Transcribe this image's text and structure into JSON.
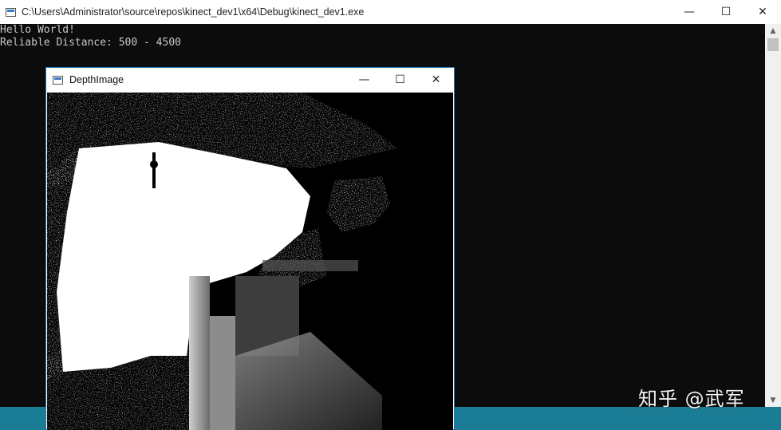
{
  "console": {
    "title": "C:\\Users\\Administrator\\source\\repos\\kinect_dev1\\x64\\Debug\\kinect_dev1.exe",
    "lines": [
      "Hello World!",
      "Reliable Distance: 500 - 4500"
    ],
    "minimize_glyph": "—",
    "maximize_glyph": "☐",
    "close_glyph": "✕",
    "scroll_up_glyph": "▲",
    "scroll_down_glyph": "▼"
  },
  "depth_window": {
    "title": "DepthImage",
    "minimize_glyph": "—",
    "maximize_glyph": "☐",
    "close_glyph": "✕"
  },
  "watermark": "知乎 @武军",
  "colors": {
    "console_bg": "#0c0c0c",
    "console_text": "#c8c8c8",
    "taskbar": "#1b7d95",
    "window_border": "#1e73b5"
  }
}
